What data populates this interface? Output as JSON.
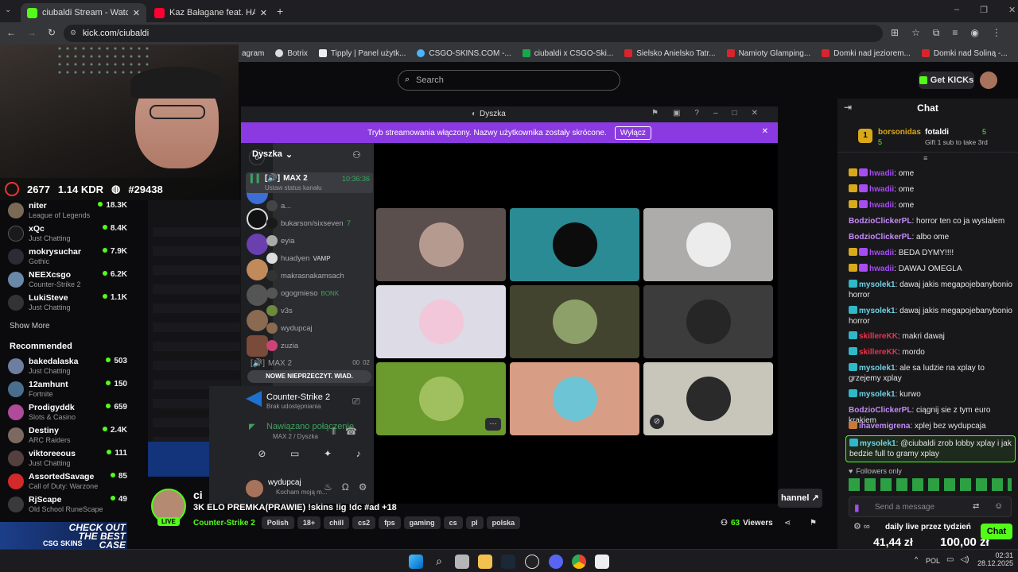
{
  "browser": {
    "tabs": [
      {
        "label": "ciubaldi Stream - Watch Live on"
      },
      {
        "label": "Kaz Bałagane feat. HAŁASTRA"
      }
    ],
    "url": "kick.com/ciubaldi",
    "bookmarks": [
      "agram",
      "Botrix",
      "Tipply | Panel użytk...",
      "CSGO-SKINS.COM -...",
      "ciubaldi x CSGO-Ski...",
      "Sielsko Anielsko Tatr...",
      "Namioty Glamping...",
      "Domki nad jeziorem...",
      "Domki nad Soliną -..."
    ]
  },
  "kick": {
    "search_placeholder": "Search",
    "get_kicks": "Get KICKs"
  },
  "stream_overlay": {
    "stat1": "2677",
    "stat2": "1.14 KDR",
    "stat3": "#29438"
  },
  "sidebar": {
    "following": [
      {
        "name": "niter",
        "game": "League of Legends",
        "viewers": "18.3K"
      },
      {
        "name": "xQc",
        "game": "Just Chatting",
        "viewers": "8.4K"
      },
      {
        "name": "mokrysuchar",
        "game": "Gothic",
        "viewers": "7.9K"
      },
      {
        "name": "NEEXcsgo",
        "game": "Counter-Strike 2",
        "viewers": "6.2K"
      },
      {
        "name": "LukiSteve",
        "game": "Just Chatting",
        "viewers": "1.1K"
      }
    ],
    "show_more": "Show More",
    "recommended_title": "Recommended",
    "recommended": [
      {
        "name": "bakedalaska",
        "game": "Just Chatting",
        "viewers": "503"
      },
      {
        "name": "12amhunt",
        "game": "Fortnite",
        "viewers": "150"
      },
      {
        "name": "Prodigyddk",
        "game": "Slots & Casino",
        "viewers": "659"
      },
      {
        "name": "Destiny",
        "game": "ARC Raiders",
        "viewers": "2.4K"
      },
      {
        "name": "viktoreeous",
        "game": "Just Chatting",
        "viewers": "111"
      },
      {
        "name": "AssortedSavage",
        "game": "Call of Duty: Warzone",
        "viewers": "85"
      },
      {
        "name": "RjScape",
        "game": "Old School RuneScape",
        "viewers": "49"
      }
    ],
    "ad_text": "CHECK OUT THE BEST CASE",
    "ad_brand": "CSG SKINS"
  },
  "discord": {
    "title": "Dyszka",
    "banner": "Tryb streamowania włączony. Nazwy użytkownika zostały skrócone.",
    "banner_btn": "Wyłącz",
    "server": "Dyszka",
    "server_badge": "0",
    "channel": "MAX 2",
    "channel_time": "10:36:36",
    "status_hint": "Ustaw status kanału",
    "voice_users": [
      "a...",
      "bukarson/sixseven",
      "eyia",
      "huadyen",
      "makrasnakamsach",
      "ogogmieso",
      "v3s",
      "wydupcaj",
      "zuzia"
    ],
    "vamp": "VAMP",
    "bonk": "BONK",
    "seven": "7",
    "channel2": "MAX 2",
    "channel2_time": "00",
    "channel2_count": "02",
    "new_unread": "NOWE NIEPRZECZYT. WIAD.",
    "activity_game": "Counter-Strike 2",
    "activity_status": "Brak udostępniania",
    "connected": "Nawiązano połączenie",
    "connected_sub": "MAX 2 / Dyszka",
    "me_name": "wydupcaj",
    "me_status": "Kocham moją m..."
  },
  "stream": {
    "channel_name": "ci",
    "live": "LIVE",
    "title": "3K ELO PREMKA(PRAWIE) !skins !ig !dc #ad +18",
    "category": "Counter-Strike 2",
    "tags": [
      "Polish",
      "18+",
      "chill",
      "cs2",
      "fps",
      "gaming",
      "cs",
      "pl",
      "polska"
    ],
    "viewers": "63",
    "viewers_label": "Viewers",
    "channel_btn": "hannel"
  },
  "chat": {
    "title": "Chat",
    "pinned_user1": "borsonidas",
    "pinned_count1": "5",
    "pinned_user2": "fotaldi",
    "pinned_count2": "5",
    "pinned_text": "Gift 1 sub to take 3rd",
    "rank": "1",
    "messages": [
      {
        "user": "hwadii",
        "text": "ome"
      },
      {
        "user": "hwadii",
        "text": "ome"
      },
      {
        "user": "hwadii",
        "text": "ome"
      },
      {
        "user": "BodzioClickerPL",
        "text": "horror ten co ja wyslalem"
      },
      {
        "user": "BodzioClickerPL",
        "text": "albo ome"
      },
      {
        "user": "hwadii",
        "text": "BEDA DYMY!!!!"
      },
      {
        "user": "hwadii",
        "text": "DAWAJ OMEGLA"
      },
      {
        "user": "mysolek1",
        "text": "dawaj jakis megapojebanybonio horror"
      },
      {
        "user": "mysolek1",
        "text": "dawaj jakis megapojebanybonio horror"
      },
      {
        "user": "skillereKK",
        "text": "makri dawaj"
      },
      {
        "user": "skillereKK",
        "text": "mordo"
      },
      {
        "user": "mysolek1",
        "text": "ale sa ludzie na xplay to grzejemy xplay"
      },
      {
        "user": "mysolek1",
        "text": "kurwo"
      },
      {
        "user": "BodzioClickerPL",
        "text": "ciągnij sie z tym euro krakiem"
      },
      {
        "user": "ihavemigrena",
        "text": "xplej bez wydupcaja"
      },
      {
        "user": "mysolek1",
        "text": "@ciubaldi zrob lobby xplay i jak bedzie full to gramy xplay"
      }
    ],
    "followers_only": "Followers only",
    "input_placeholder": "Send a message",
    "send": "Chat",
    "overlay_text": "daily live przez tydzień",
    "overlay_amount1": "41,44 zł",
    "overlay_amount2": "100,00 zł"
  },
  "taskbar": {
    "lang": "POL",
    "time": "02:31",
    "date": "28.12.2025"
  }
}
